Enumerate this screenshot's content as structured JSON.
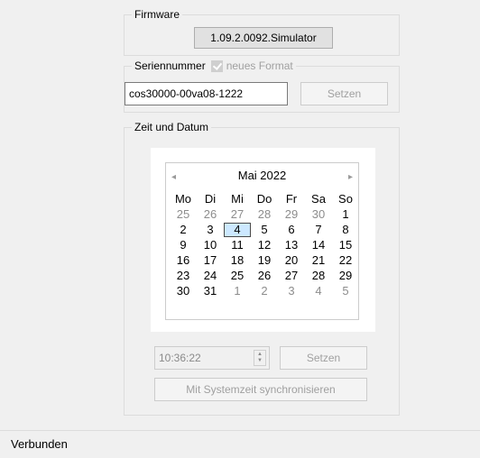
{
  "firmware": {
    "legend": "Firmware",
    "version": "1.09.2.0092.Simulator"
  },
  "serial": {
    "legend": "Seriennummer",
    "checkbox_label": "neues Format",
    "value": "cos30000-00va08-1222",
    "set_button": "Setzen"
  },
  "datetime": {
    "legend": "Zeit und Datum",
    "calendar": {
      "prev_icon": "◂",
      "next_icon": "▸",
      "month_title": "Mai 2022",
      "weekdays": [
        "Mo",
        "Di",
        "Mi",
        "Do",
        "Fr",
        "Sa",
        "So"
      ],
      "weeks": [
        [
          "25",
          "26",
          "27",
          "28",
          "29",
          "30",
          "1"
        ],
        [
          "2",
          "3",
          "4",
          "5",
          "6",
          "7",
          "8"
        ],
        [
          "9",
          "10",
          "11",
          "12",
          "13",
          "14",
          "15"
        ],
        [
          "16",
          "17",
          "18",
          "19",
          "20",
          "21",
          "22"
        ],
        [
          "23",
          "24",
          "25",
          "26",
          "27",
          "28",
          "29"
        ],
        [
          "30",
          "31",
          "1",
          "2",
          "3",
          "4",
          "5"
        ]
      ],
      "selected_day": "4"
    },
    "time_value": "10:36:22",
    "set_button": "Setzen",
    "sync_button": "Mit Systemzeit synchronisieren"
  },
  "status": {
    "text": "Verbunden"
  },
  "colors": {
    "window_bg": "#f0f0f0",
    "selected_day_bg": "#cce8ff",
    "disabled_text": "#a0a0a0"
  }
}
